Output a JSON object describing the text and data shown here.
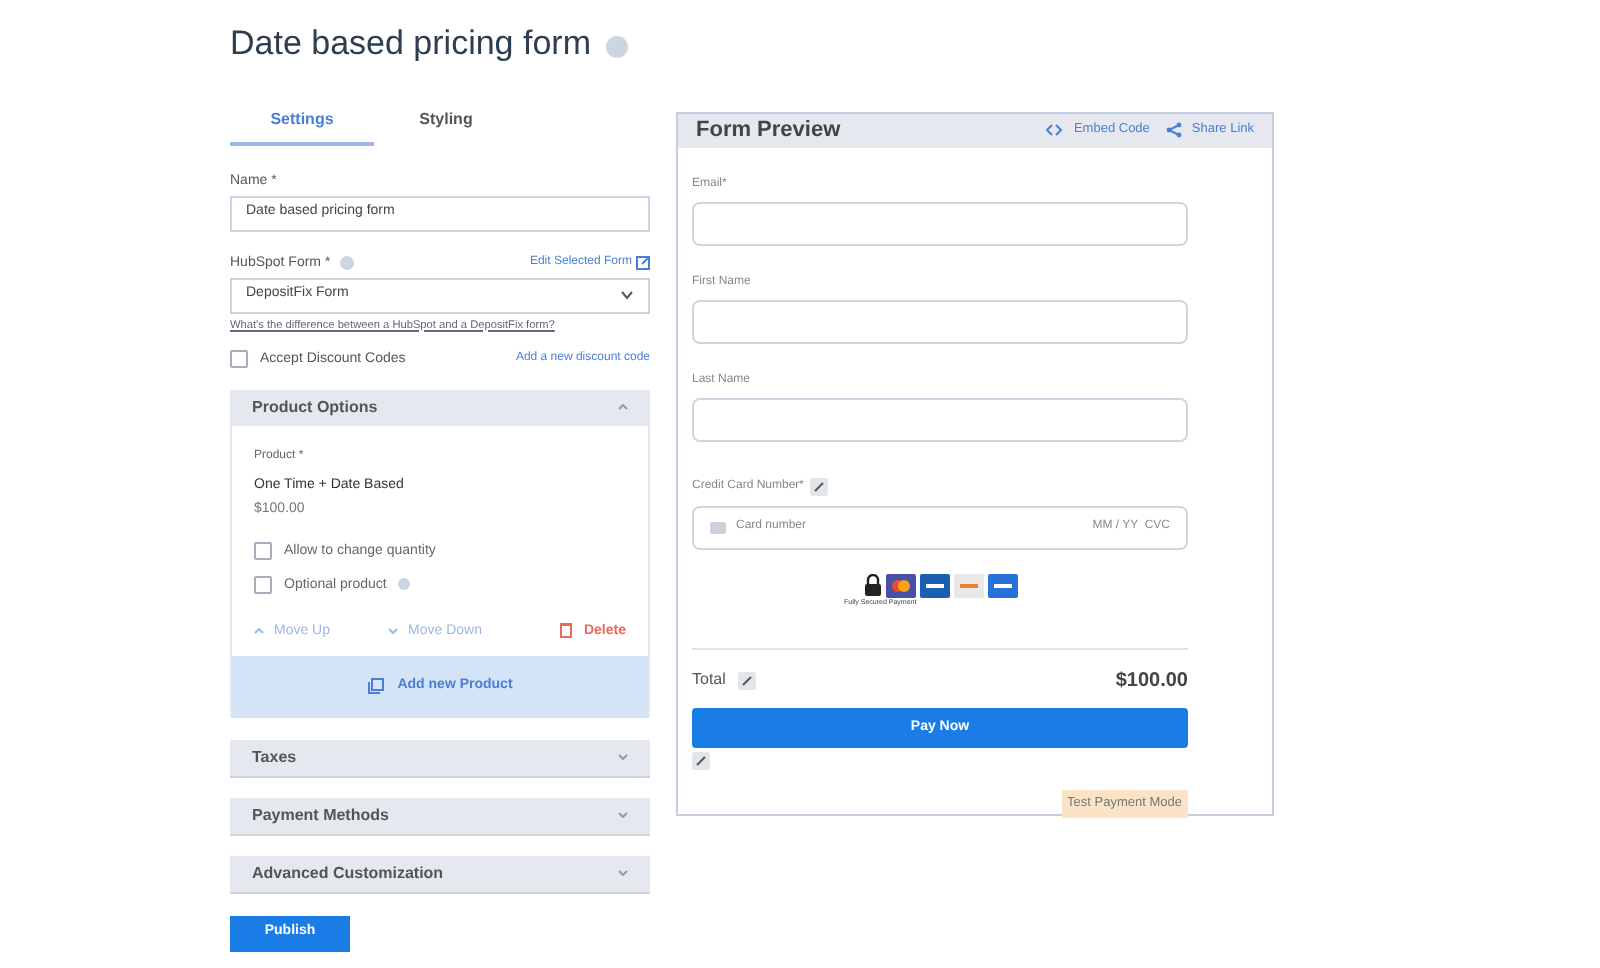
{
  "title": "Date based pricing form",
  "tabs": [
    {
      "label": "Settings",
      "selected": true
    },
    {
      "label": "Styling",
      "selected": false
    }
  ],
  "name_field": {
    "label": "Name *",
    "value": "Date based pricing form"
  },
  "hubspot_field": {
    "label": "HubSpot Form *",
    "link": "Edit Selected Form",
    "value": "DepositFix Form",
    "help_link": "What's the difference between a HubSpot and a DepositFix form?"
  },
  "discount": {
    "label": "Accept Discount Codes",
    "checked": false,
    "link": "Add a new discount code"
  },
  "product_options": {
    "title": "Product Options",
    "expanded": true,
    "product_label": "Product *",
    "product_name": "One Time + Date Based",
    "price": "$100.00",
    "options": [
      {
        "label": "Allow to change quantity",
        "checked": false,
        "help": false
      },
      {
        "label": "Optional product",
        "checked": false,
        "help": true
      }
    ],
    "move_up": "Move Up",
    "move_down": "Move Down",
    "delete": "Delete",
    "add": "Add new Product"
  },
  "sections": [
    {
      "title": "Taxes",
      "expanded": false
    },
    {
      "title": "Payment Methods",
      "expanded": false
    },
    {
      "title": "Advanced Customization",
      "expanded": false
    }
  ],
  "publish": "Publish",
  "preview": {
    "title": "Form Preview",
    "embed": "Embed Code",
    "share": "Share Link",
    "fields": [
      {
        "label": "Email*"
      },
      {
        "label": "First Name"
      },
      {
        "label": "Last Name"
      }
    ],
    "card_label": "Credit Card Number*",
    "card_placeholder": "Card number",
    "card_right": "MM / YY  CVC",
    "secure_text": "Fully Secured Payment",
    "total_label": "Total",
    "total": "$100.00",
    "pay": "Pay Now",
    "mode": "Test Payment Mode"
  }
}
